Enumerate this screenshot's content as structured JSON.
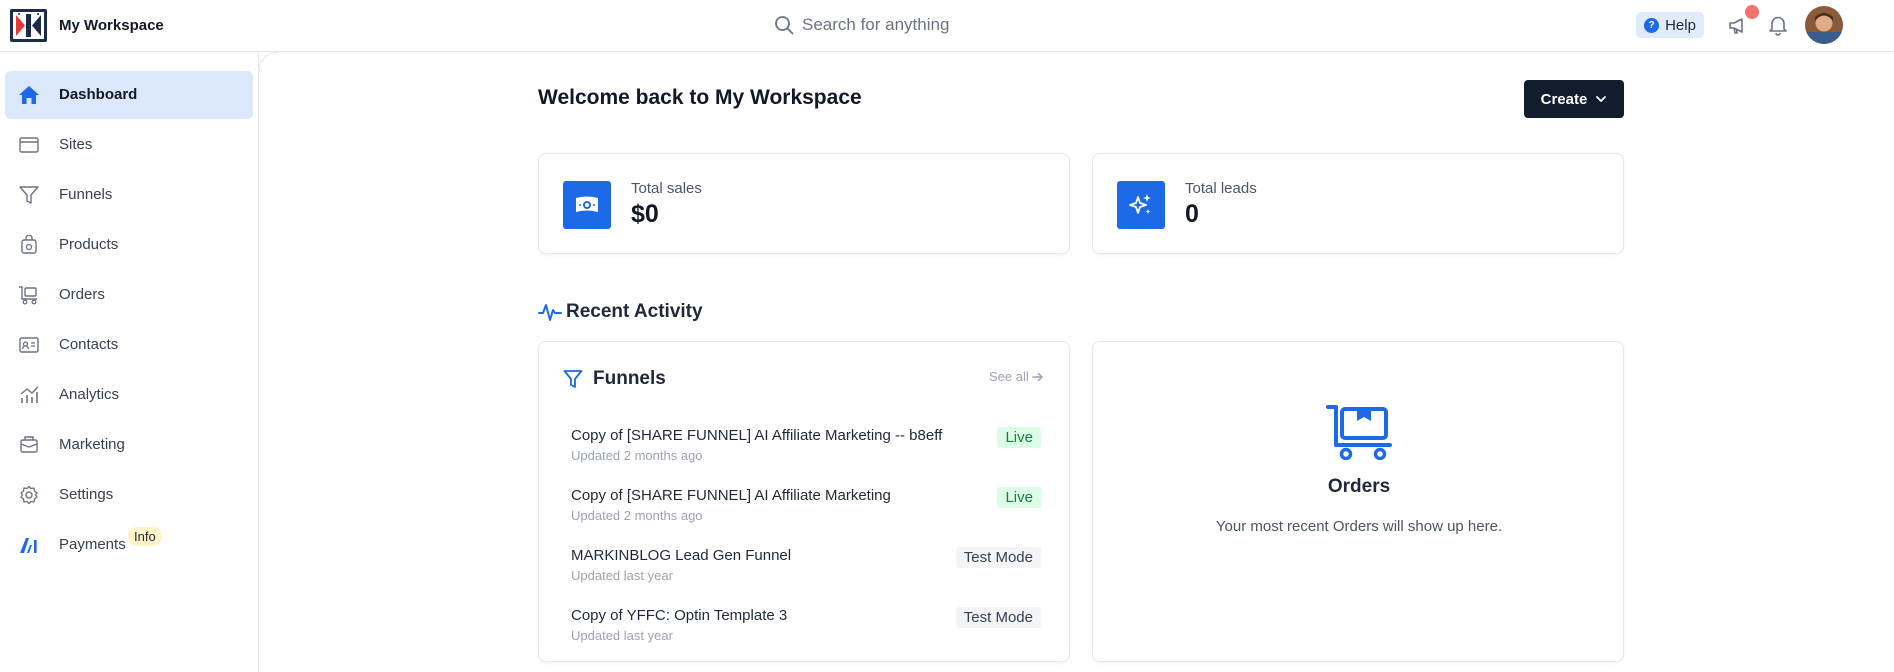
{
  "header": {
    "workspace_name": "My Workspace",
    "search_placeholder": "Search for anything",
    "help_label": "Help",
    "help_glyph": "?"
  },
  "sidebar": {
    "items": [
      {
        "label": "Dashboard",
        "icon": "home-icon",
        "active": true
      },
      {
        "label": "Sites",
        "icon": "browser-window-icon"
      },
      {
        "label": "Funnels",
        "icon": "funnel-icon"
      },
      {
        "label": "Products",
        "icon": "product-box-icon"
      },
      {
        "label": "Orders",
        "icon": "cart-icon"
      },
      {
        "label": "Contacts",
        "icon": "contact-card-icon"
      },
      {
        "label": "Analytics",
        "icon": "chart-icon"
      },
      {
        "label": "Marketing",
        "icon": "marketing-icon"
      },
      {
        "label": "Settings",
        "icon": "gear-icon"
      },
      {
        "label": "Payments",
        "icon": "payments-logo-icon",
        "badge": "Info"
      }
    ]
  },
  "main": {
    "welcome": "Welcome back to My Workspace",
    "create_label": "Create",
    "stats": [
      {
        "label": "Total sales",
        "value": "$0",
        "icon": "money-icon"
      },
      {
        "label": "Total leads",
        "value": "0",
        "icon": "sparkles-icon"
      }
    ],
    "recent_activity_title": "Recent Activity",
    "funnels_card": {
      "title": "Funnels",
      "see_all": "See all",
      "rows": [
        {
          "name": "Copy of [SHARE FUNNEL] AI Affiliate Marketing -- b8eff",
          "updated": "Updated 2 months ago",
          "status": "Live"
        },
        {
          "name": "Copy of [SHARE FUNNEL] AI Affiliate Marketing",
          "updated": "Updated 2 months ago",
          "status": "Live"
        },
        {
          "name": "MARKINBLOG Lead Gen Funnel",
          "updated": "Updated last year",
          "status": "Test Mode"
        },
        {
          "name": "Copy of YFFC: Optin Template 3",
          "updated": "Updated last year",
          "status": "Test Mode"
        }
      ]
    },
    "orders_card": {
      "title": "Orders",
      "empty_text": "Your most recent Orders will show up here."
    }
  },
  "colors": {
    "accent": "#1d6ae6",
    "active_nav_bg": "#dbe8fb",
    "create_bg": "#111c2d",
    "live_bg": "#dcfce7",
    "live_text": "#15803d",
    "info_badge_bg": "#fef3c7",
    "notification_dot": "#f87171"
  }
}
